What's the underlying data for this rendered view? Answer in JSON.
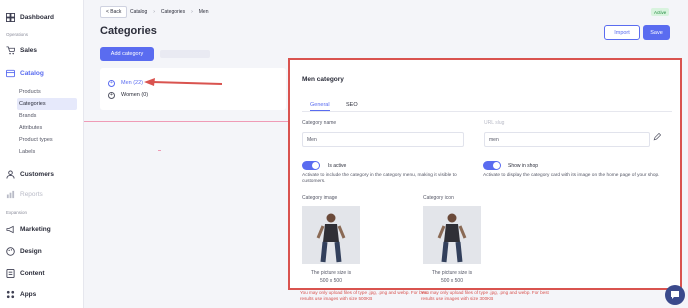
{
  "sidebar": {
    "dashboard": "Dashboard",
    "section_operations": "Operations",
    "sales": "Sales",
    "catalog": "Catalog",
    "catalog_sub": [
      "Products",
      "Categories",
      "Brands",
      "Attributes",
      "Product types",
      "Labels"
    ],
    "customers": "Customers",
    "reports": "Reports",
    "section_expansion": "Expansion",
    "marketing": "Marketing",
    "design": "Design",
    "content": "Content",
    "apps": "Apps"
  },
  "topbar": {
    "back_label": "< Back",
    "breadcrumb": [
      "Catalog",
      "Categories",
      "Men"
    ],
    "status_badge": "Active"
  },
  "header": {
    "title": "Categories",
    "import_label": "Import",
    "save_label": "Save",
    "add_category_label": "Add category"
  },
  "tree": {
    "items": [
      {
        "label": "Men (22)",
        "selected": true
      },
      {
        "label": "Women (0)",
        "selected": false
      }
    ]
  },
  "panel": {
    "title": "Men category",
    "tabs": [
      "General",
      "SEO"
    ],
    "active_tab": "General",
    "category_name_label": "Category name",
    "category_name_value": "Men",
    "url_slug_label": "URL slug",
    "url_slug_value": "men",
    "is_active_label": "Is active",
    "is_active_desc": "Activate to include the category in the category menu, making it visible to customers.",
    "show_in_shop_label": "Show in shop",
    "show_in_shop_desc": "Activate to display the category card with its image on the home page of your shop.",
    "category_image_label": "Category image",
    "category_icon_label": "Category icon",
    "picture_note_line1": "The picture size is",
    "picture_note_line2": "500 x 500",
    "image_warning": "You may only upload files of type .jpg, .png and webp. For best results use images with size 500KB",
    "icon_warning": "You may only upload files of type .jpg, .png and webp. For best results use images with size 300KB"
  },
  "colors": {
    "accent": "#5a6cf0",
    "highlight_border": "#d9534f",
    "status_bg": "#d8f3de",
    "status_text": "#1f8a3e"
  }
}
